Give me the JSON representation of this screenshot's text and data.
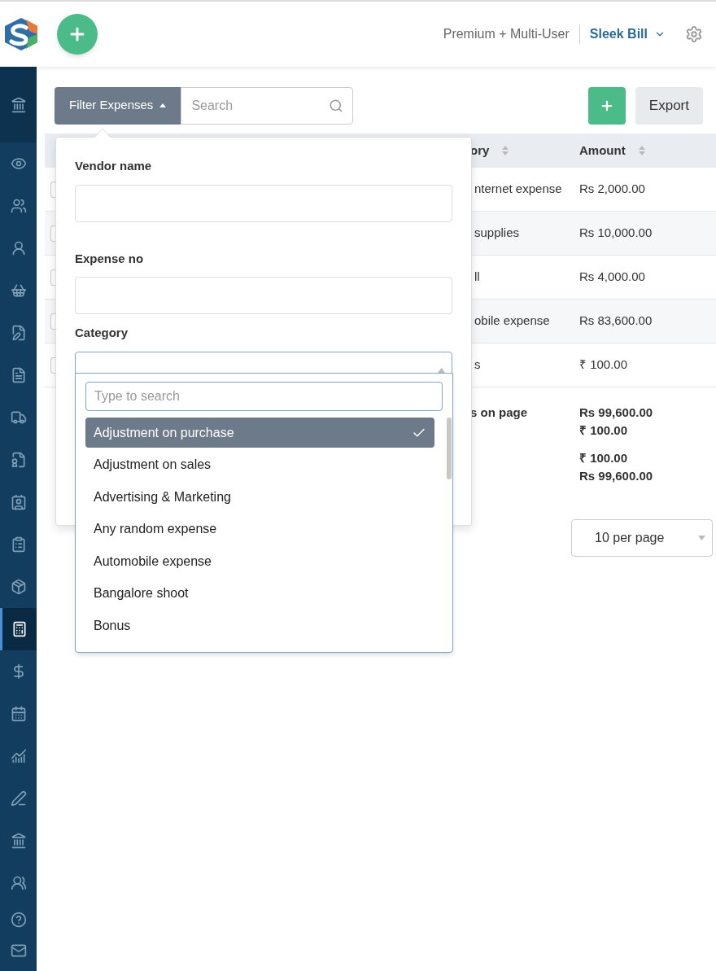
{
  "header": {
    "plan": "Premium + Multi-User",
    "company": "Sleek Bill"
  },
  "sidebar": {
    "items": [
      {
        "selected": false
      },
      {
        "selected": false
      },
      {
        "selected": false
      },
      {
        "selected": false
      },
      {
        "selected": false
      },
      {
        "selected": false
      },
      {
        "selected": false
      },
      {
        "selected": false
      },
      {
        "selected": false
      },
      {
        "selected": false
      },
      {
        "selected": false
      },
      {
        "selected": false
      },
      {
        "selected": true
      },
      {
        "selected": false
      },
      {
        "selected": false
      },
      {
        "selected": false
      },
      {
        "selected": false
      },
      {
        "selected": false
      },
      {
        "selected": false
      },
      {
        "selected": false
      },
      {
        "selected": false
      }
    ]
  },
  "toolbar": {
    "filter_button": "Filter Expenses",
    "search": {
      "placeholder": "Search"
    },
    "export_button": "Export"
  },
  "table": {
    "columns": [
      "ory",
      "Amount"
    ],
    "rows": [
      {
        "checked": false,
        "category": "nternet expense",
        "amount": "Rs 2,000.00"
      },
      {
        "checked": false,
        "category": "supplies",
        "amount": "Rs 10,000.00"
      },
      {
        "checked": false,
        "category": "ll",
        "amount": "Rs 4,000.00"
      },
      {
        "checked": false,
        "category": "obile expense",
        "amount": "Rs 83,600.00"
      },
      {
        "checked": false,
        "category": "s",
        "amount": "₹ 100.00"
      }
    ],
    "totals": {
      "label": "s on page",
      "groups": [
        [
          "Rs 99,600.00",
          "₹ 100.00"
        ],
        [
          "₹ 100.00",
          "Rs 99,600.00"
        ]
      ]
    }
  },
  "pagination": {
    "per_page": "10 per page"
  },
  "filter_panel": {
    "fields": [
      {
        "label": "Vendor name"
      },
      {
        "label": "Expense no"
      }
    ],
    "category": {
      "label": "Category",
      "search": {
        "placeholder": "Type to search"
      },
      "options": [
        {
          "label": "Adjustment on purchase",
          "selected": true
        },
        {
          "label": "Adjustment on sales",
          "selected": false
        },
        {
          "label": "Advertising & Marketing",
          "selected": false
        },
        {
          "label": "Any random expense",
          "selected": false
        },
        {
          "label": "Automobile expense",
          "selected": false
        },
        {
          "label": "Bangalore shoot",
          "selected": false
        },
        {
          "label": "Bonus",
          "selected": false
        }
      ]
    }
  }
}
